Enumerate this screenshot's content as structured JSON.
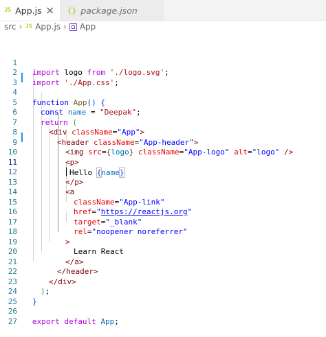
{
  "tabs": [
    {
      "icon": "JS",
      "label": "App.js",
      "close": "×"
    },
    {
      "icon": "{}",
      "label": "package.json"
    }
  ],
  "breadcrumb": {
    "folder": "src",
    "file_icon": "JS",
    "file": "App.js",
    "symbol": "App"
  },
  "line_numbers": [
    "1",
    "2",
    "3",
    "4",
    "5",
    "6",
    "7",
    "8",
    "9",
    "10",
    "11",
    "12",
    "13",
    "14",
    "15",
    "16",
    "17",
    "18",
    "19",
    "20",
    "21",
    "22",
    "23",
    "24",
    "25",
    "26",
    "27"
  ],
  "code": {
    "l1": [
      "import",
      " logo ",
      "from",
      " ",
      "'./logo.svg'",
      ";"
    ],
    "l2": [
      "import",
      " ",
      "'./App.css'",
      ";"
    ],
    "l4": [
      "function",
      " ",
      "App",
      "(",
      ")",
      " {"
    ],
    "l5": [
      "const",
      " ",
      "name",
      " = ",
      "\"Deepak\"",
      ";"
    ],
    "l6": [
      "return",
      " ",
      "("
    ],
    "l7": [
      "<",
      "div",
      " ",
      "className",
      "=",
      "\"App\"",
      ">"
    ],
    "l8": [
      "<",
      "header",
      " ",
      "className",
      "=",
      "\"App-header\"",
      ">"
    ],
    "l9": [
      "<",
      "img",
      " ",
      "src",
      "=",
      "{",
      "logo",
      "}",
      " ",
      "className",
      "=",
      "\"App-logo\"",
      " ",
      "alt",
      "=",
      "\"logo\"",
      " />"
    ],
    "l10": [
      "<",
      "p",
      ">"
    ],
    "l11": [
      "Hello ",
      "{",
      "name",
      "}"
    ],
    "l12": [
      "</",
      "p",
      ">"
    ],
    "l13": [
      "<",
      "a"
    ],
    "l14": [
      "className",
      "=",
      "\"App-link\""
    ],
    "l15": [
      "href",
      "=",
      "\"",
      "https://reactjs.org",
      "\""
    ],
    "l16": [
      "target",
      "=",
      "\"_blank\""
    ],
    "l17": [
      "rel",
      "=",
      "\"noopener noreferrer\""
    ],
    "l18": [
      ">"
    ],
    "l19": [
      "Learn React"
    ],
    "l20": [
      "</",
      "a",
      ">"
    ],
    "l21": [
      "</",
      "header",
      ">"
    ],
    "l22": [
      "</",
      "div",
      ">"
    ],
    "l23": [
      ")",
      ";"
    ],
    "l24": [
      "}"
    ],
    "l26": [
      "export",
      " ",
      "default",
      " ",
      "App",
      ";"
    ]
  }
}
